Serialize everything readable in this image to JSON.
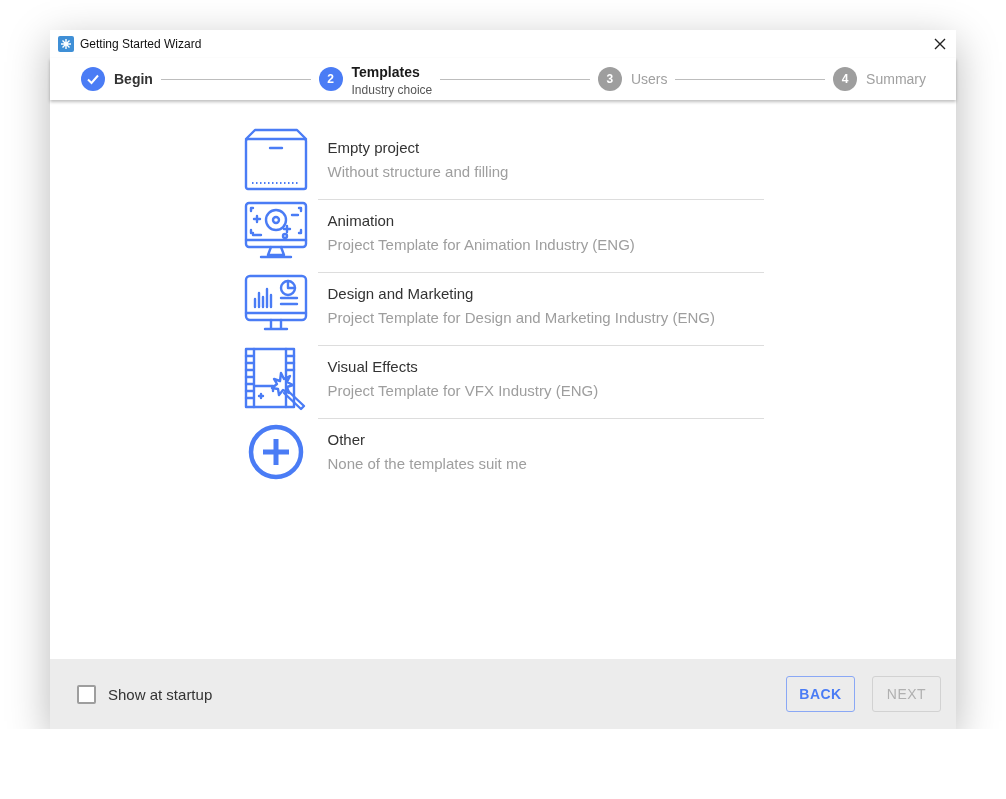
{
  "window": {
    "title": "Getting Started Wizard"
  },
  "steps": [
    {
      "label": "Begin",
      "completed": true,
      "selected": false
    },
    {
      "number": "2",
      "label": "Templates",
      "sublabel": "Industry choice",
      "completed": false,
      "selected": true
    },
    {
      "number": "3",
      "label": "Users",
      "completed": false,
      "selected": false
    },
    {
      "number": "4",
      "label": "Summary",
      "completed": false,
      "selected": false
    }
  ],
  "templates": [
    {
      "kind": "empty",
      "title": "Empty project",
      "description": "Without structure and filling"
    },
    {
      "kind": "animation",
      "title": "Animation",
      "description": "Project Template for Animation Industry (ENG)"
    },
    {
      "kind": "design",
      "title": "Design and Marketing",
      "description": "Project Template for Design and Marketing Industry (ENG)"
    },
    {
      "kind": "vfx",
      "title": "Visual Effects",
      "description": "Project Template for VFX Industry (ENG)"
    },
    {
      "kind": "other",
      "title": "Other",
      "description": "None of the templates suit me"
    }
  ],
  "footer": {
    "show_at_startup": {
      "label": "Show at startup",
      "checked": false
    },
    "buttons": [
      {
        "label": "BACK",
        "disabled": false
      },
      {
        "label": "NEXT",
        "disabled": true
      }
    ]
  }
}
